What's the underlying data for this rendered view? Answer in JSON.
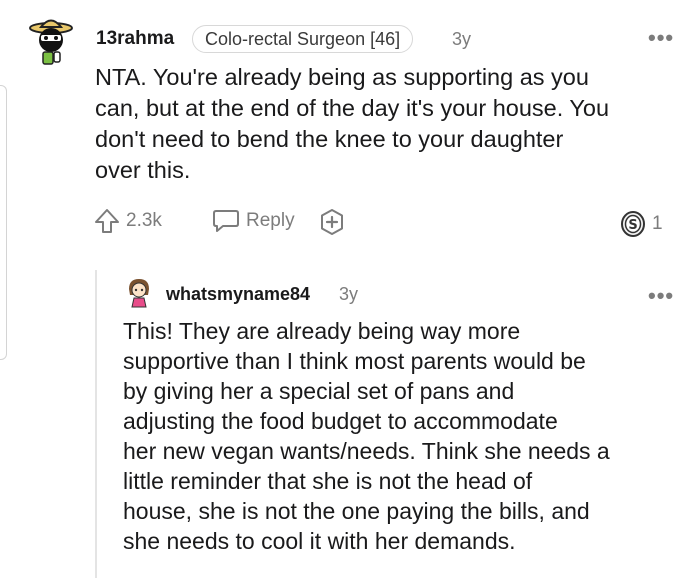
{
  "comment": {
    "username": "13rahma",
    "flair": "Colo-rectal Surgeon [46]",
    "time": "3y",
    "more_label": "•••",
    "lines": [
      "NTA. You're already being as supporting as you",
      "can, but at the end of the day it's your house. You",
      "don't need to bend the knee to your daughter",
      "over this."
    ],
    "actions": {
      "upvote_count": "2.3k",
      "reply_label": "Reply",
      "award_count": "1"
    }
  },
  "reply": {
    "username": "whatsmyname84",
    "time": "3y",
    "more_label": "•••",
    "lines": [
      "This! They are already being way more",
      "supportive than I think most parents would be",
      "by giving her a special set of pans and",
      "adjusting the food budget to accommodate",
      "her new vegan wants/needs. Think she needs a",
      "little reminder that she is not the head of",
      "house, she is not the one paying the bills, and",
      "she needs to cool it with her demands."
    ]
  },
  "icons": {
    "comment_avatar": "sombrero-avatar-icon",
    "reply_avatar": "girl-avatar-icon",
    "upvote": "upvote-arrow-icon",
    "reply": "speech-bubble-icon",
    "award": "plus-award-icon",
    "silver_award": "silver-award-icon"
  },
  "colors": {
    "text": "#1a1a1b",
    "muted": "#7c7c7c",
    "flair_border": "#d8d8d8"
  }
}
